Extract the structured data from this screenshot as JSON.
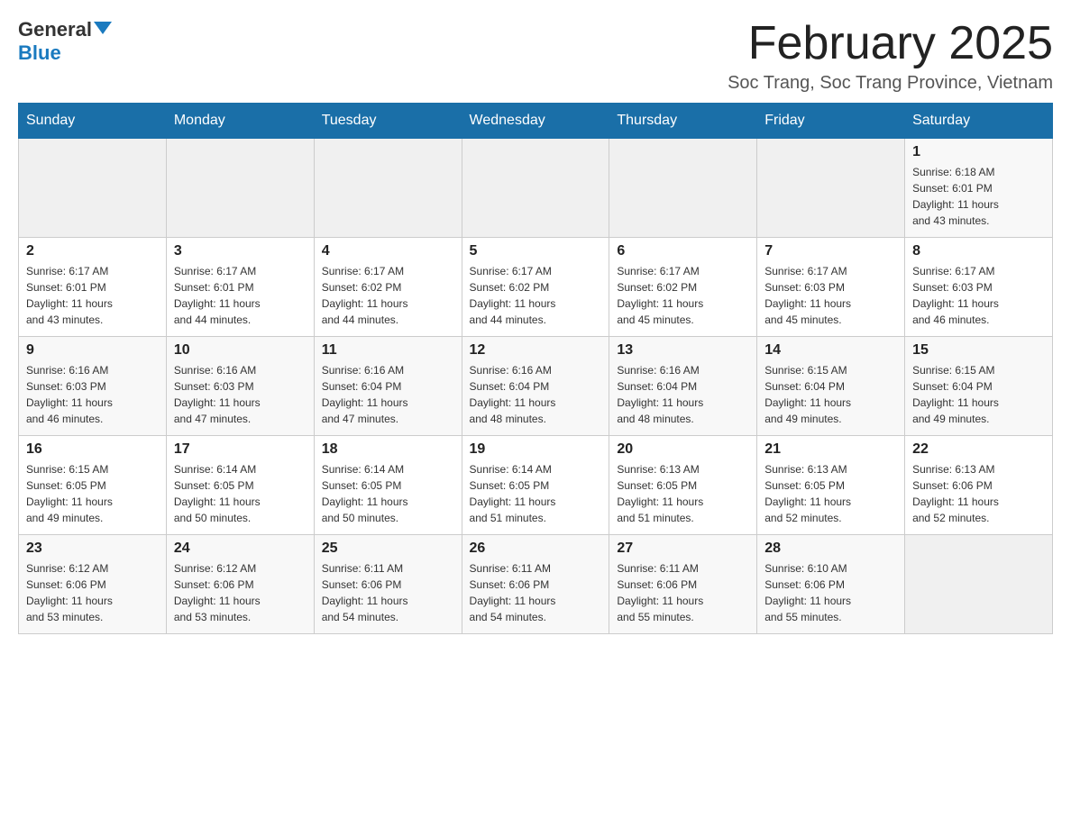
{
  "header": {
    "logo_general": "General",
    "logo_blue": "Blue",
    "title": "February 2025",
    "location": "Soc Trang, Soc Trang Province, Vietnam"
  },
  "days_of_week": [
    "Sunday",
    "Monday",
    "Tuesday",
    "Wednesday",
    "Thursday",
    "Friday",
    "Saturday"
  ],
  "weeks": [
    [
      {
        "day": "",
        "info": ""
      },
      {
        "day": "",
        "info": ""
      },
      {
        "day": "",
        "info": ""
      },
      {
        "day": "",
        "info": ""
      },
      {
        "day": "",
        "info": ""
      },
      {
        "day": "",
        "info": ""
      },
      {
        "day": "1",
        "info": "Sunrise: 6:18 AM\nSunset: 6:01 PM\nDaylight: 11 hours\nand 43 minutes."
      }
    ],
    [
      {
        "day": "2",
        "info": "Sunrise: 6:17 AM\nSunset: 6:01 PM\nDaylight: 11 hours\nand 43 minutes."
      },
      {
        "day": "3",
        "info": "Sunrise: 6:17 AM\nSunset: 6:01 PM\nDaylight: 11 hours\nand 44 minutes."
      },
      {
        "day": "4",
        "info": "Sunrise: 6:17 AM\nSunset: 6:02 PM\nDaylight: 11 hours\nand 44 minutes."
      },
      {
        "day": "5",
        "info": "Sunrise: 6:17 AM\nSunset: 6:02 PM\nDaylight: 11 hours\nand 44 minutes."
      },
      {
        "day": "6",
        "info": "Sunrise: 6:17 AM\nSunset: 6:02 PM\nDaylight: 11 hours\nand 45 minutes."
      },
      {
        "day": "7",
        "info": "Sunrise: 6:17 AM\nSunset: 6:03 PM\nDaylight: 11 hours\nand 45 minutes."
      },
      {
        "day": "8",
        "info": "Sunrise: 6:17 AM\nSunset: 6:03 PM\nDaylight: 11 hours\nand 46 minutes."
      }
    ],
    [
      {
        "day": "9",
        "info": "Sunrise: 6:16 AM\nSunset: 6:03 PM\nDaylight: 11 hours\nand 46 minutes."
      },
      {
        "day": "10",
        "info": "Sunrise: 6:16 AM\nSunset: 6:03 PM\nDaylight: 11 hours\nand 47 minutes."
      },
      {
        "day": "11",
        "info": "Sunrise: 6:16 AM\nSunset: 6:04 PM\nDaylight: 11 hours\nand 47 minutes."
      },
      {
        "day": "12",
        "info": "Sunrise: 6:16 AM\nSunset: 6:04 PM\nDaylight: 11 hours\nand 48 minutes."
      },
      {
        "day": "13",
        "info": "Sunrise: 6:16 AM\nSunset: 6:04 PM\nDaylight: 11 hours\nand 48 minutes."
      },
      {
        "day": "14",
        "info": "Sunrise: 6:15 AM\nSunset: 6:04 PM\nDaylight: 11 hours\nand 49 minutes."
      },
      {
        "day": "15",
        "info": "Sunrise: 6:15 AM\nSunset: 6:04 PM\nDaylight: 11 hours\nand 49 minutes."
      }
    ],
    [
      {
        "day": "16",
        "info": "Sunrise: 6:15 AM\nSunset: 6:05 PM\nDaylight: 11 hours\nand 49 minutes."
      },
      {
        "day": "17",
        "info": "Sunrise: 6:14 AM\nSunset: 6:05 PM\nDaylight: 11 hours\nand 50 minutes."
      },
      {
        "day": "18",
        "info": "Sunrise: 6:14 AM\nSunset: 6:05 PM\nDaylight: 11 hours\nand 50 minutes."
      },
      {
        "day": "19",
        "info": "Sunrise: 6:14 AM\nSunset: 6:05 PM\nDaylight: 11 hours\nand 51 minutes."
      },
      {
        "day": "20",
        "info": "Sunrise: 6:13 AM\nSunset: 6:05 PM\nDaylight: 11 hours\nand 51 minutes."
      },
      {
        "day": "21",
        "info": "Sunrise: 6:13 AM\nSunset: 6:05 PM\nDaylight: 11 hours\nand 52 minutes."
      },
      {
        "day": "22",
        "info": "Sunrise: 6:13 AM\nSunset: 6:06 PM\nDaylight: 11 hours\nand 52 minutes."
      }
    ],
    [
      {
        "day": "23",
        "info": "Sunrise: 6:12 AM\nSunset: 6:06 PM\nDaylight: 11 hours\nand 53 minutes."
      },
      {
        "day": "24",
        "info": "Sunrise: 6:12 AM\nSunset: 6:06 PM\nDaylight: 11 hours\nand 53 minutes."
      },
      {
        "day": "25",
        "info": "Sunrise: 6:11 AM\nSunset: 6:06 PM\nDaylight: 11 hours\nand 54 minutes."
      },
      {
        "day": "26",
        "info": "Sunrise: 6:11 AM\nSunset: 6:06 PM\nDaylight: 11 hours\nand 54 minutes."
      },
      {
        "day": "27",
        "info": "Sunrise: 6:11 AM\nSunset: 6:06 PM\nDaylight: 11 hours\nand 55 minutes."
      },
      {
        "day": "28",
        "info": "Sunrise: 6:10 AM\nSunset: 6:06 PM\nDaylight: 11 hours\nand 55 minutes."
      },
      {
        "day": "",
        "info": ""
      }
    ]
  ]
}
